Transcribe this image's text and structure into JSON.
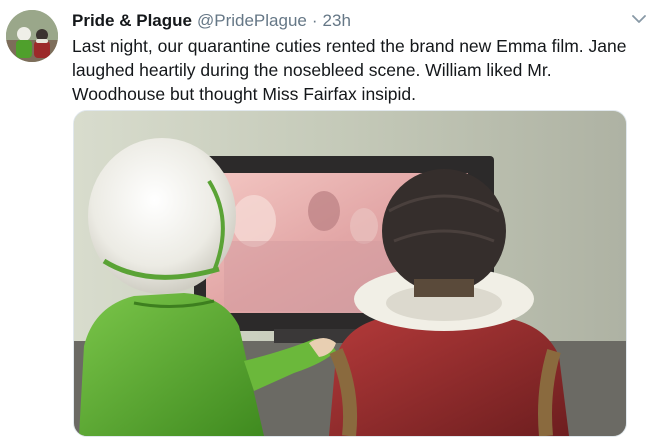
{
  "tweet": {
    "display_name": "Pride & Plague",
    "handle": "@PridePlague",
    "separator": "·",
    "timestamp": "23h",
    "text_lines": [
      "Last night, our quarantine cuties rented the brand new Emma film.  Jane",
      "laughed heartily during the nosebleed scene.  William liked Mr.",
      "Woodhouse but thought Miss Fairfax insipid."
    ]
  },
  "icons": {
    "menu": "chevron-down-icon",
    "avatar": "avatar-figurines"
  },
  "colors": {
    "text_primary": "#14171a",
    "text_secondary": "#657786",
    "border": "#e1e8ed"
  }
}
